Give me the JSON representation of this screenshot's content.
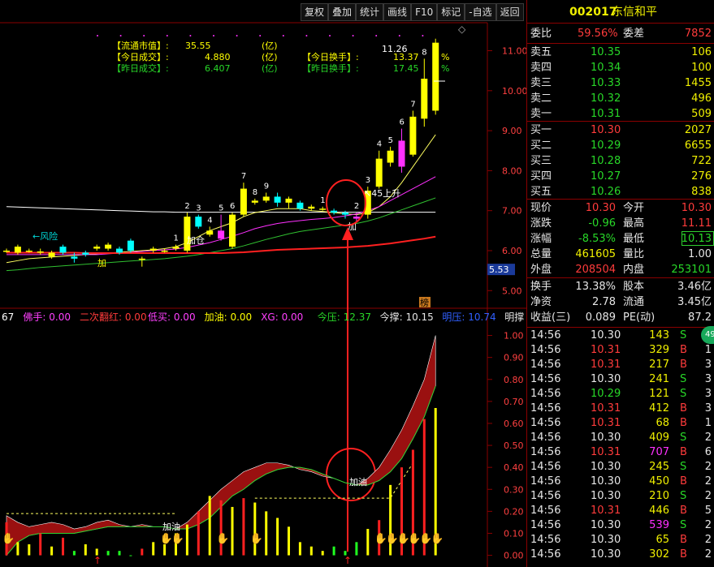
{
  "toolbar": [
    "复权",
    "叠加",
    "统计",
    "画线",
    "F10",
    "标记",
    "-自选",
    "返回"
  ],
  "stock": {
    "code": "002017",
    "name": "东信和平"
  },
  "info_box": {
    "float_mv_label": "【流通市值】:",
    "float_mv": "35.55",
    "float_mv_unit": "(亿)",
    "today_amt_label": "【今日成交】:",
    "today_amt": "4.880",
    "today_amt_unit": "(亿)",
    "yest_amt_label": "【昨日成交】:",
    "yest_amt": "6.407",
    "yest_amt_unit": "(亿)",
    "today_turn_label": "【今日换手】:",
    "today_turn": "13.37",
    "today_turn_unit": "%",
    "yest_turn_label": "【昨日换手】:",
    "yest_turn": "17.45",
    "yest_turn_unit": "%"
  },
  "main_labels": {
    "high": "11.26",
    "risk": "←风险",
    "add1": "加",
    "add2": "加仓",
    "rise": "45上升",
    "add3": "加",
    "bang": "榜",
    "axis_label": "5.53",
    "digits": [
      "1",
      "2",
      "3",
      "4",
      "5",
      "6",
      "7",
      "8",
      "9",
      "1",
      "2",
      "3",
      "4",
      "5",
      "6",
      "7",
      "8"
    ]
  },
  "indicator_header": [
    {
      "text": "67",
      "color": "#ffffff"
    },
    {
      "text": "佛手: 0.00",
      "color": "#ff40ff"
    },
    {
      "text": "二次翻红: 0.00",
      "color": "#ff3b3b"
    },
    {
      "text": "低买: 0.00",
      "color": "#ff40ff"
    },
    {
      "text": "加油: 0.00",
      "color": "#ffff00"
    },
    {
      "text": "XG: 0.00",
      "color": "#ff40ff"
    },
    {
      "text": "今压: 12.37",
      "color": "#28d828"
    },
    {
      "text": "今撑: 10.15",
      "color": "#e6e6e6"
    },
    {
      "text": "明压: 10.74",
      "color": "#3060ff"
    },
    {
      "text": "明撑",
      "color": "#e6e6e6"
    }
  ],
  "sub_labels": {
    "add_oil_1": "加油",
    "add_oil_2": "加油"
  },
  "chart_data": [
    {
      "type": "candlestick",
      "yaxis": [
        "5.00",
        "6.00",
        "7.00",
        "8.00",
        "9.00",
        "10.00",
        "11.00"
      ],
      "ylim": [
        4.6,
        11.7
      ],
      "series_name": "",
      "candles": [
        {
          "o": 6.0,
          "c": 6.0,
          "h": 6.05,
          "l": 5.95
        },
        {
          "o": 5.95,
          "c": 6.1,
          "h": 6.15,
          "l": 5.9
        },
        {
          "o": 6.0,
          "c": 6.0,
          "h": 6.05,
          "l": 5.95
        },
        {
          "o": 5.95,
          "c": 5.98,
          "h": 6.05,
          "l": 5.9
        },
        {
          "o": 5.85,
          "c": 5.95,
          "h": 6.0,
          "l": 5.8
        },
        {
          "o": 6.1,
          "c": 5.95,
          "h": 6.15,
          "l": 5.9
        },
        {
          "o": 5.85,
          "c": 5.8,
          "h": 5.95,
          "l": 5.7
        },
        {
          "o": 5.95,
          "c": 5.9,
          "h": 6.0,
          "l": 5.85
        },
        {
          "o": 6.05,
          "c": 6.1,
          "h": 6.15,
          "l": 6.0
        },
        {
          "o": 6.05,
          "c": 6.15,
          "h": 6.2,
          "l": 6.0
        },
        {
          "o": 6.05,
          "c": 5.95,
          "h": 6.1,
          "l": 5.9
        },
        {
          "o": 6.25,
          "c": 6.0,
          "h": 6.3,
          "l": 5.95
        },
        {
          "o": 5.8,
          "c": 5.8,
          "h": 5.85,
          "l": 5.6
        },
        {
          "o": 6.0,
          "c": 6.05,
          "h": 6.1,
          "l": 5.95
        },
        {
          "o": 6.0,
          "c": 6.0,
          "h": 6.05,
          "l": 5.95
        },
        {
          "o": 6.05,
          "c": 6.1,
          "h": 6.15,
          "l": 6.0
        },
        {
          "o": 6.0,
          "c": 6.85,
          "h": 6.95,
          "l": 5.95
        },
        {
          "o": 6.85,
          "c": 6.6,
          "h": 6.9,
          "l": 6.55
        },
        {
          "o": 6.4,
          "c": 6.5,
          "h": 6.6,
          "l": 6.35
        },
        {
          "o": 6.3,
          "c": 6.5,
          "h": 6.9,
          "l": 6.25
        },
        {
          "o": 6.1,
          "c": 6.9,
          "h": 6.95,
          "l": 6.05
        },
        {
          "o": 6.9,
          "c": 7.55,
          "h": 7.7,
          "l": 6.85
        },
        {
          "o": 7.2,
          "c": 7.25,
          "h": 7.3,
          "l": 7.15
        },
        {
          "o": 7.25,
          "c": 7.35,
          "h": 7.45,
          "l": 7.2
        },
        {
          "o": 7.35,
          "c": 7.2,
          "h": 7.45,
          "l": 7.1
        },
        {
          "o": 7.2,
          "c": 7.3,
          "h": 7.35,
          "l": 7.05
        },
        {
          "o": 7.2,
          "c": 7.05,
          "h": 7.25,
          "l": 7.0
        },
        {
          "o": 7.05,
          "c": 7.1,
          "h": 7.15,
          "l": 7.0
        },
        {
          "o": 7.05,
          "c": 7.05,
          "h": 7.1,
          "l": 7.0
        },
        {
          "o": 7.0,
          "c": 6.95,
          "h": 7.05,
          "l": 6.9
        },
        {
          "o": 6.95,
          "c": 6.9,
          "h": 7.0,
          "l": 6.8
        },
        {
          "o": 6.85,
          "c": 6.8,
          "h": 6.95,
          "l": 6.7
        },
        {
          "o": 6.9,
          "c": 7.5,
          "h": 7.6,
          "l": 6.8
        },
        {
          "o": 7.6,
          "c": 8.3,
          "h": 8.5,
          "l": 7.55
        },
        {
          "o": 8.2,
          "c": 8.5,
          "h": 8.6,
          "l": 8.1
        },
        {
          "o": 8.1,
          "c": 8.75,
          "h": 9.05,
          "l": 7.95
        },
        {
          "o": 8.4,
          "c": 9.35,
          "h": 9.5,
          "l": 8.35
        },
        {
          "o": 9.3,
          "c": 10.3,
          "h": 10.8,
          "l": 9.1
        },
        {
          "o": 9.5,
          "c": 11.2,
          "h": 11.3,
          "l": 9.4
        }
      ],
      "ma_lines": [
        {
          "color": "#ffffff",
          "values": [
            7.1,
            7.09,
            7.08,
            7.07,
            7.06,
            7.05,
            7.04,
            7.03,
            7.02,
            7.01,
            7.0,
            6.99,
            6.98,
            6.97,
            6.97,
            6.96,
            6.96,
            6.96,
            6.96,
            6.96,
            6.96,
            6.96,
            6.96,
            6.96,
            6.96,
            6.96,
            6.96,
            6.96,
            6.96,
            6.96,
            6.96,
            6.96,
            6.96,
            6.96,
            6.96,
            6.96,
            6.96,
            6.96,
            6.96
          ]
        },
        {
          "color": "#ffff60",
          "values": [
            5.7,
            5.75,
            5.8,
            5.82,
            5.84,
            5.86,
            5.88,
            5.9,
            5.92,
            5.94,
            5.96,
            5.98,
            6.0,
            6.02,
            6.05,
            6.1,
            6.2,
            6.35,
            6.5,
            6.6,
            6.7,
            6.85,
            6.95,
            7.0,
            7.05,
            7.05,
            7.05,
            7.0,
            6.98,
            6.95,
            6.92,
            6.9,
            6.95,
            7.1,
            7.35,
            7.7,
            8.1,
            8.5,
            8.9
          ]
        },
        {
          "color": "#30c030",
          "values": [
            5.5,
            5.52,
            5.55,
            5.58,
            5.6,
            5.62,
            5.64,
            5.66,
            5.68,
            5.7,
            5.72,
            5.74,
            5.76,
            5.78,
            5.8,
            5.83,
            5.86,
            5.9,
            5.95,
            6.0,
            6.05,
            6.12,
            6.2,
            6.28,
            6.35,
            6.42,
            6.48,
            6.52,
            6.56,
            6.6,
            6.64,
            6.68,
            6.74,
            6.82,
            6.92,
            7.02,
            7.12,
            7.22,
            7.32
          ]
        },
        {
          "color": "#ff30ff",
          "values": [
            5.9,
            5.9,
            5.9,
            5.9,
            5.9,
            5.9,
            5.9,
            5.9,
            5.9,
            5.92,
            5.94,
            5.96,
            5.98,
            6.0,
            6.02,
            6.04,
            6.08,
            6.14,
            6.2,
            6.28,
            6.36,
            6.45,
            6.55,
            6.62,
            6.68,
            6.72,
            6.75,
            6.78,
            6.8,
            6.83,
            6.87,
            6.92,
            7.0,
            7.1,
            7.25,
            7.4,
            7.55,
            7.7,
            7.85
          ]
        },
        {
          "color": "#ff2020",
          "values": [
            5.95,
            5.95,
            5.95,
            5.95,
            5.95,
            5.95,
            5.95,
            5.94,
            5.94,
            5.94,
            5.94,
            5.94,
            5.94,
            5.94,
            5.94,
            5.94,
            5.94,
            5.94,
            5.94,
            5.94,
            5.95,
            5.96,
            5.98,
            6.0,
            6.02,
            6.03,
            6.04,
            6.05,
            6.06,
            6.07,
            6.08,
            6.1,
            6.12,
            6.15,
            6.18,
            6.22,
            6.26,
            6.3,
            6.35
          ]
        }
      ]
    },
    {
      "type": "area",
      "yaxis": [
        "0.00",
        "0.10",
        "0.20",
        "0.30",
        "0.40",
        "0.50",
        "0.60",
        "0.70",
        "0.80",
        "0.90",
        "1.00"
      ],
      "ylim": [
        -0.02,
        1.05
      ],
      "series_name": "",
      "upper": [
        0.18,
        0.15,
        0.13,
        0.14,
        0.15,
        0.14,
        0.12,
        0.13,
        0.15,
        0.16,
        0.14,
        0.13,
        0.14,
        0.13,
        0.13,
        0.12,
        0.15,
        0.2,
        0.25,
        0.3,
        0.34,
        0.38,
        0.4,
        0.42,
        0.42,
        0.41,
        0.39,
        0.38,
        0.36,
        0.35,
        0.33,
        0.32,
        0.35,
        0.4,
        0.48,
        0.57,
        0.68,
        0.8,
        1.0
      ],
      "lower": [
        0.0,
        0.06,
        0.09,
        0.1,
        0.1,
        0.1,
        0.1,
        0.11,
        0.12,
        0.13,
        0.13,
        0.13,
        0.13,
        0.13,
        0.13,
        0.12,
        0.12,
        0.14,
        0.17,
        0.22,
        0.27,
        0.3,
        0.34,
        0.37,
        0.39,
        0.4,
        0.4,
        0.39,
        0.37,
        0.35,
        0.33,
        0.32,
        0.32,
        0.34,
        0.38,
        0.44,
        0.53,
        0.63,
        0.77
      ],
      "bars": [
        0.15,
        0.06,
        0.05,
        0.1,
        0.04,
        0.08,
        0.02,
        0.05,
        0.03,
        0.02,
        0.02,
        0.0,
        0.03,
        0.06,
        0.05,
        0.1,
        0.14,
        0.2,
        0.27,
        0.25,
        0.22,
        0.26,
        0.24,
        0.2,
        0.17,
        0.13,
        0.06,
        0.04,
        0.02,
        0.04,
        0.02,
        0.06,
        0.12,
        0.16,
        0.32,
        0.4,
        0.48,
        0.62,
        0.67
      ],
      "bar_colors": [
        "#ff2020",
        "#ffff00",
        "#ffff00",
        "#ff2020",
        "#ffff00",
        "#ff2020",
        "#20ff20",
        "#ffff00",
        "#ffff00",
        "#20ff20",
        "#20ff20",
        "#20ff20",
        "#ff2020",
        "#ffff00",
        "#ffff00",
        "#ffff00",
        "#ffff00",
        "#ff2020",
        "#ffff00",
        "#ff2020",
        "#ffff00",
        "#ff2020",
        "#ffff00",
        "#ffff00",
        "#ffff00",
        "#ffff00",
        "#ffff00",
        "#ffff00",
        "#ffff00",
        "#20ff20",
        "#20ff20",
        "#20ff20",
        "#ffff00",
        "#ff2020",
        "#ffff00",
        "#ff2020",
        "#ff2020",
        "#ff2020",
        "#ffff00"
      ]
    }
  ],
  "quote": {
    "wb_label": "委比",
    "wb": "59.56%",
    "wc_label": "委差",
    "wc": "7852",
    "asks": [
      {
        "label": "卖五",
        "price": "10.35",
        "vol": "106"
      },
      {
        "label": "卖四",
        "price": "10.34",
        "vol": "100"
      },
      {
        "label": "卖三",
        "price": "10.33",
        "vol": "1455"
      },
      {
        "label": "卖二",
        "price": "10.32",
        "vol": "496"
      },
      {
        "label": "卖一",
        "price": "10.31",
        "vol": "509"
      }
    ],
    "bids": [
      {
        "label": "买一",
        "price": "10.30",
        "vol": "2027"
      },
      {
        "label": "买二",
        "price": "10.29",
        "vol": "6655"
      },
      {
        "label": "买三",
        "price": "10.28",
        "vol": "722"
      },
      {
        "label": "买四",
        "price": "10.27",
        "vol": "276"
      },
      {
        "label": "买五",
        "price": "10.26",
        "vol": "838"
      }
    ],
    "stats": [
      {
        "l1": "现价",
        "v1": "10.30",
        "c1": "red",
        "l2": "今开",
        "v2": "10.30",
        "c2": "red"
      },
      {
        "l1": "涨跌",
        "v1": "-0.96",
        "c1": "green",
        "l2": "最高",
        "v2": "11.11",
        "c2": "red"
      },
      {
        "l1": "涨幅",
        "v1": "-8.53%",
        "c1": "green",
        "l2": "最低",
        "v2": "10.13",
        "c2": "green"
      },
      {
        "l1": "总量",
        "v1": "461605",
        "c1": "yellow",
        "l2": "量比",
        "v2": "1.00",
        "c2": "white"
      },
      {
        "l1": "外盘",
        "v1": "208504",
        "c1": "red",
        "l2": "内盘",
        "v2": "253101",
        "c2": "green"
      }
    ],
    "stats2": [
      {
        "l1": "换手",
        "v1": "13.38%",
        "l2": "股本",
        "v2": "3.46亿"
      },
      {
        "l1": "净资",
        "v1": "2.78",
        "l2": "流通",
        "v2": "3.45亿"
      },
      {
        "l1": "收益(三)",
        "v1": "0.089",
        "l2": "PE(动)",
        "v2": "87.2"
      }
    ],
    "trades": [
      {
        "t": "14:56",
        "p": "10.30",
        "v": "143",
        "s": "S",
        "n": "1"
      },
      {
        "t": "14:56",
        "p": "10.31",
        "v": "329",
        "s": "B",
        "n": "1"
      },
      {
        "t": "14:56",
        "p": "10.31",
        "v": "217",
        "s": "B",
        "n": "3"
      },
      {
        "t": "14:56",
        "p": "10.30",
        "v": "241",
        "s": "S",
        "n": "3"
      },
      {
        "t": "14:56",
        "p": "10.29",
        "v": "121",
        "s": "S",
        "n": "3"
      },
      {
        "t": "14:56",
        "p": "10.31",
        "v": "412",
        "s": "B",
        "n": "3"
      },
      {
        "t": "14:56",
        "p": "10.31",
        "v": "68",
        "s": "B",
        "n": "1"
      },
      {
        "t": "14:56",
        "p": "10.30",
        "v": "409",
        "s": "S",
        "n": "2"
      },
      {
        "t": "14:56",
        "p": "10.31",
        "v": "707",
        "s": "B",
        "n": "6"
      },
      {
        "t": "14:56",
        "p": "10.30",
        "v": "245",
        "s": "S",
        "n": "2"
      },
      {
        "t": "14:56",
        "p": "10.30",
        "v": "450",
        "s": "B",
        "n": "2"
      },
      {
        "t": "14:56",
        "p": "10.30",
        "v": "210",
        "s": "S",
        "n": "2"
      },
      {
        "t": "14:56",
        "p": "10.31",
        "v": "446",
        "s": "B",
        "n": "5"
      },
      {
        "t": "14:56",
        "p": "10.30",
        "v": "539",
        "s": "S",
        "n": "2"
      },
      {
        "t": "14:56",
        "p": "10.30",
        "v": "65",
        "s": "B",
        "n": "2"
      },
      {
        "t": "14:56",
        "p": "10.30",
        "v": "302",
        "s": "B",
        "n": "2"
      }
    ],
    "bubble": "49"
  }
}
